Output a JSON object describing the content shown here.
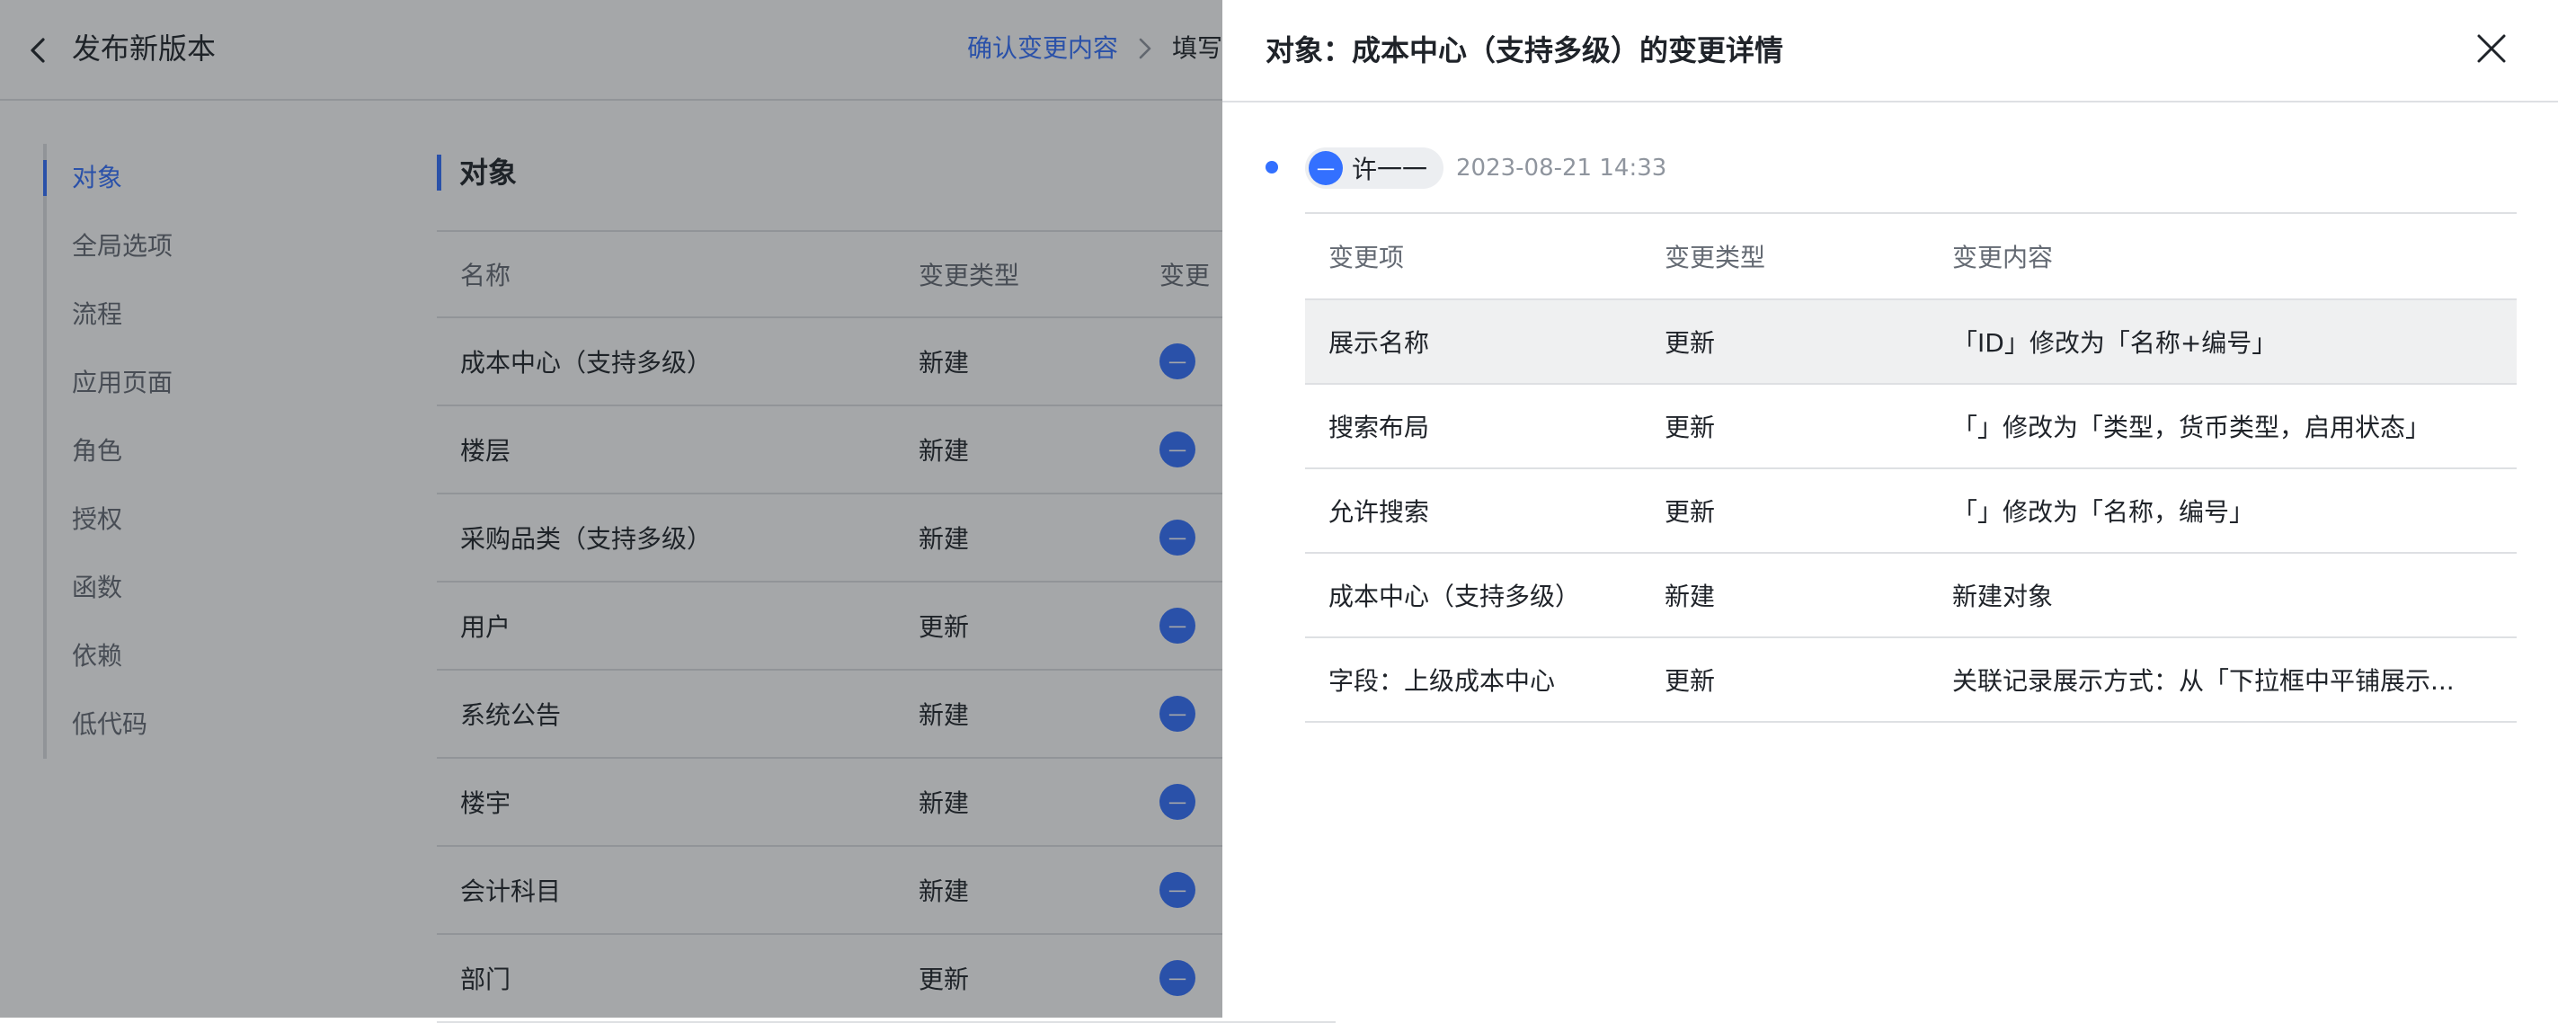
{
  "header": {
    "title": "发布新版本",
    "steps": {
      "active": "确认变更内容",
      "next": "填写"
    }
  },
  "sidenav": {
    "items": [
      {
        "label": "对象",
        "active": true
      },
      {
        "label": "全局选项"
      },
      {
        "label": "流程"
      },
      {
        "label": "应用页面"
      },
      {
        "label": "角色"
      },
      {
        "label": "授权"
      },
      {
        "label": "函数"
      },
      {
        "label": "依赖"
      },
      {
        "label": "低代码"
      }
    ]
  },
  "main": {
    "section_title": "对象",
    "table": {
      "columns": [
        "名称",
        "变更类型",
        "变更"
      ],
      "rows": [
        {
          "name": "成本中心（支持多级）",
          "type": "新建",
          "avatar": "一"
        },
        {
          "name": "楼层",
          "type": "新建",
          "avatar": "一"
        },
        {
          "name": "采购品类（支持多级）",
          "type": "新建",
          "avatar": "一"
        },
        {
          "name": "用户",
          "type": "更新",
          "avatar": "一"
        },
        {
          "name": "系统公告",
          "type": "新建",
          "avatar": "一"
        },
        {
          "name": "楼宇",
          "type": "新建",
          "avatar": "一"
        },
        {
          "name": "会计科目",
          "type": "新建",
          "avatar": "一"
        },
        {
          "name": "部门",
          "type": "更新",
          "avatar": "一"
        }
      ]
    }
  },
  "drawer": {
    "title": "对象：成本中心（支持多级）的变更详情",
    "log": {
      "avatar": "一",
      "user": "许一一",
      "time": "2023-08-21 14:33"
    },
    "table": {
      "columns": [
        "变更项",
        "变更类型",
        "变更内容"
      ],
      "rows": [
        {
          "item": "展示名称",
          "type": "更新",
          "content": "「ID」修改为「名称+编号」"
        },
        {
          "item": "搜索布局",
          "type": "更新",
          "content": "「」修改为「类型，货币类型，启用状态」"
        },
        {
          "item": "允许搜索",
          "type": "更新",
          "content": "「」修改为「名称，编号」"
        },
        {
          "item": "成本中心（支持多级）",
          "type": "新建",
          "content": "新建对象"
        },
        {
          "item": "字段：上级成本中心",
          "type": "更新",
          "content": "关联记录展示方式：从「下拉框中平铺展示..."
        }
      ]
    }
  },
  "colors": {
    "accent": "#3370ff",
    "mask": "rgba(31,35,41,0.40)",
    "highlight_row": "#eff0f1"
  }
}
